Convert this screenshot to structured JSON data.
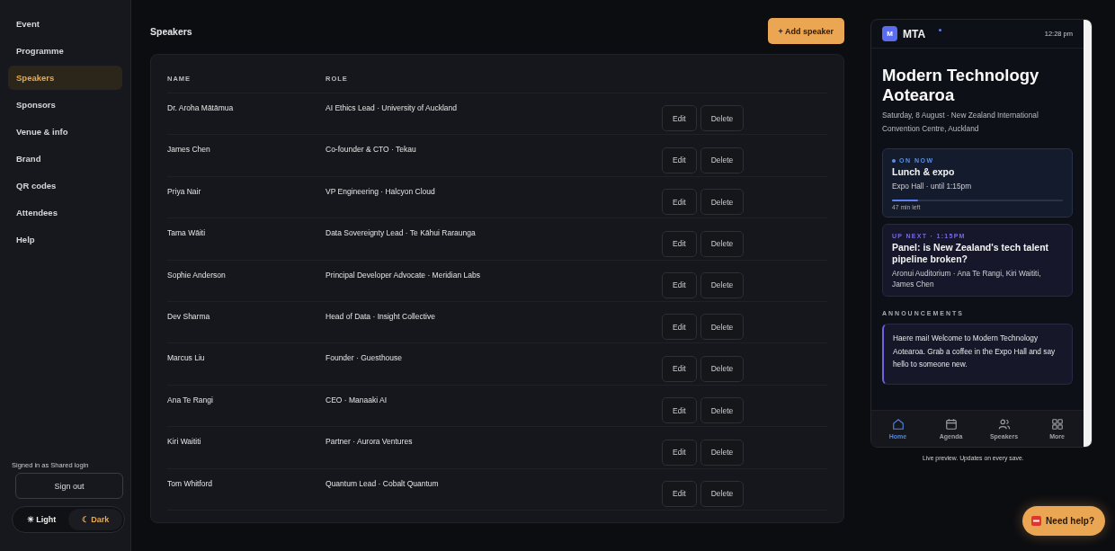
{
  "sidebar": {
    "items": [
      {
        "label": "Event",
        "selected": false
      },
      {
        "label": "Programme",
        "selected": false
      },
      {
        "label": "Speakers",
        "selected": true
      },
      {
        "label": "Sponsors",
        "selected": false
      },
      {
        "label": "Venue & info",
        "selected": false
      },
      {
        "label": "Brand",
        "selected": false
      },
      {
        "label": "QR codes",
        "selected": false
      },
      {
        "label": "Attendees",
        "selected": false
      },
      {
        "label": "Help",
        "selected": false
      }
    ],
    "signed_in": "Signed in as Shared login",
    "sign_out": "Sign out",
    "theme": [
      {
        "icon": "☀",
        "label": "Light",
        "selected": false
      },
      {
        "icon": "☾",
        "label": "Dark",
        "selected": true
      }
    ]
  },
  "page": {
    "title": "Speakers",
    "add_button": "+ Add speaker"
  },
  "table": {
    "columns": [
      "NAME",
      "ROLE"
    ],
    "rows": [
      {
        "name": "Dr. Aroha Mātāmua",
        "role": "AI Ethics Lead · University of Auckland",
        "edit": "Edit",
        "delete": "Delete"
      },
      {
        "name": "James Chen",
        "role": "Co-founder & CTO · Tekau",
        "edit": "Edit",
        "delete": "Delete"
      },
      {
        "name": "Priya Nair",
        "role": "VP Engineering · Halcyon Cloud",
        "edit": "Edit",
        "delete": "Delete"
      },
      {
        "name": "Tama Wāiti",
        "role": "Data Sovereignty Lead · Te Kāhui Raraunga",
        "edit": "Edit",
        "delete": "Delete"
      },
      {
        "name": "Sophie Anderson",
        "role": "Principal Developer Advocate · Meridian Labs",
        "edit": "Edit",
        "delete": "Delete"
      },
      {
        "name": "Dev Sharma",
        "role": "Head of Data · Insight Collective",
        "edit": "Edit",
        "delete": "Delete"
      },
      {
        "name": "Marcus Liu",
        "role": "Founder · Guesthouse",
        "edit": "Edit",
        "delete": "Delete"
      },
      {
        "name": "Ana Te Rangi",
        "role": "CEO · Manaaki AI",
        "edit": "Edit",
        "delete": "Delete"
      },
      {
        "name": "Kiri Waititi",
        "role": "Partner · Aurora Ventures",
        "edit": "Edit",
        "delete": "Delete"
      },
      {
        "name": "Tom Whitford",
        "role": "Quantum Lead · Cobalt Quantum",
        "edit": "Edit",
        "delete": "Delete"
      }
    ]
  },
  "preview": {
    "logo": "M",
    "app_name": "MTA",
    "time": "12:28 pm",
    "title": "Modern Technology Aotearoa",
    "subtitle": "Saturday, 8 August · New Zealand International Convention Centre, Auckland",
    "now": {
      "tag": "ON NOW",
      "title": "Lunch & expo",
      "detail": "Expo Hall · until 1:15pm",
      "level": 0.15,
      "left": "47 min left"
    },
    "next": {
      "tag": "UP NEXT · 1:15PM",
      "title": "Panel: is New Zealand's tech talent pipeline broken?",
      "detail": "Aronui Auditorium · Ana Te Rangi, Kiri Waititi, James Chen"
    },
    "announcements_heading": "ANNOUNCEMENTS",
    "announcement": "Haere mai! Welcome to Modern Technology Aotearoa. Grab a coffee in the Expo Hall and say hello to someone new.",
    "tabs": [
      {
        "kind": "home",
        "label": "Home",
        "selected": true
      },
      {
        "kind": "agenda",
        "label": "Agenda",
        "selected": false
      },
      {
        "kind": "speakers",
        "label": "Speakers",
        "selected": false
      },
      {
        "kind": "more",
        "label": "More",
        "selected": false
      }
    ],
    "caption": "Live preview. Updates on every save."
  },
  "help_button": {
    "label": "Need help?"
  }
}
